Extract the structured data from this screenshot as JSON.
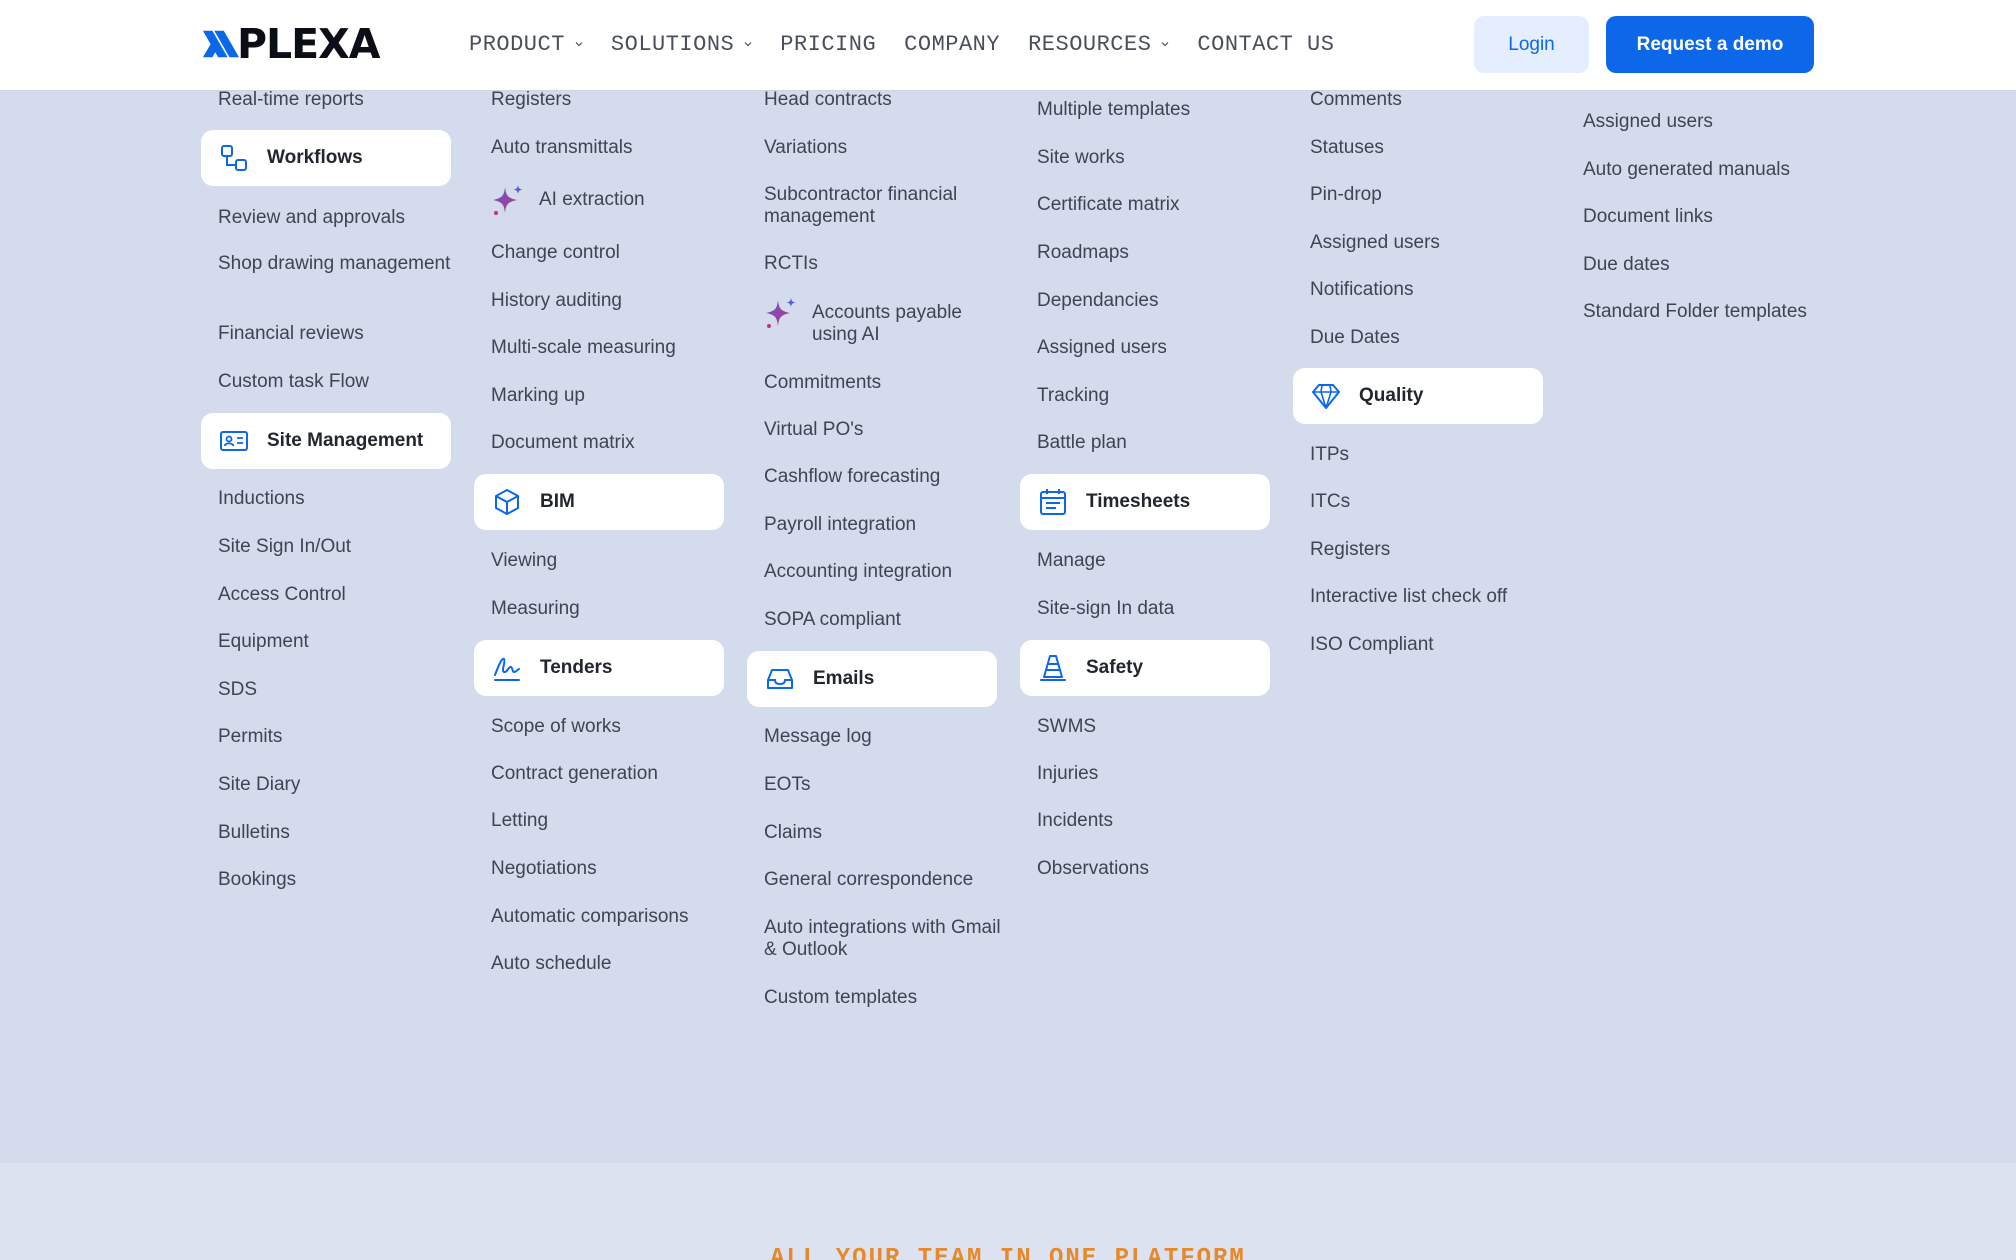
{
  "header": {
    "logo_text": "PLEXA",
    "nav": [
      {
        "label": "PRODUCT",
        "has_dropdown": true
      },
      {
        "label": "SOLUTIONS",
        "has_dropdown": true
      },
      {
        "label": "PRICING",
        "has_dropdown": false
      },
      {
        "label": "COMPANY",
        "has_dropdown": false
      },
      {
        "label": "RESOURCES",
        "has_dropdown": true
      },
      {
        "label": "CONTACT US",
        "has_dropdown": false
      }
    ],
    "login_label": "Login",
    "demo_label": "Request a demo",
    "brand_color": "#0c68e9"
  },
  "menu": {
    "col1": {
      "items": [
        "Real-time reports",
        "Review and approvals",
        "Shop drawing management",
        "Financial reviews",
        "Custom task Flow",
        "Inductions",
        "Site Sign In/Out",
        "Access Control",
        "Equipment",
        "SDS",
        "Permits",
        "Site Diary",
        "Bulletins",
        "Bookings"
      ],
      "cards": [
        {
          "label": "Workflows",
          "icon": "workflow-icon"
        },
        {
          "label": "Site Management",
          "icon": "id-card-icon"
        }
      ]
    },
    "col2": {
      "items": [
        "Registers",
        "Auto transmittals",
        "AI extraction",
        "Change control",
        "History auditing",
        "Multi-scale measuring",
        "Marking up",
        "Document matrix",
        "Viewing",
        "Measuring",
        "Scope of works",
        "Contract generation",
        "Letting",
        "Negotiations",
        "Automatic comparisons",
        "Auto schedule"
      ],
      "cards": [
        {
          "label": "BIM",
          "icon": "cube-icon"
        },
        {
          "label": "Tenders",
          "icon": "signature-icon"
        }
      ]
    },
    "col3": {
      "items": [
        "Head contracts",
        "Variations",
        "Subcontractor financial management",
        "RCTIs",
        "Accounts payable using AI",
        "Commitments",
        "Virtual PO's",
        "Cashflow forecasting",
        "Payroll integration",
        "Accounting integration",
        "SOPA compliant",
        "Message log",
        "EOTs",
        "Claims",
        "General correspondence",
        "Auto integrations with Gmail & Outlook",
        "Custom templates"
      ],
      "cards": [
        {
          "label": "Emails",
          "icon": "inbox-icon"
        }
      ]
    },
    "col4": {
      "items": [
        "Multiple templates",
        "Site works",
        "Certificate matrix",
        "Roadmaps",
        "Dependancies",
        "Assigned users",
        "Tracking",
        "Battle plan",
        "Manage",
        "Site-sign In data",
        "SWMS",
        "Injuries",
        "Incidents",
        "Observations"
      ],
      "cards": [
        {
          "label": "Timesheets",
          "icon": "calendar-icon"
        },
        {
          "label": "Safety",
          "icon": "cone-icon"
        }
      ]
    },
    "col5": {
      "items": [
        "Comments",
        "Statuses",
        "Pin-drop",
        "Assigned users",
        "Notifications",
        "Due Dates",
        "ITPs",
        "ITCs",
        "Registers",
        "Interactive list check off",
        "ISO Compliant"
      ],
      "cards": [
        {
          "label": "Quality",
          "icon": "diamond-icon"
        }
      ]
    },
    "col6": {
      "items": [
        "Assigned users",
        "Auto generated manuals",
        "Document links",
        "Due dates",
        "Standard Folder templates"
      ]
    }
  },
  "lower": {
    "heading": "ALL YOUR TEAM IN ONE PLATFORM",
    "heading_color": "#e6892a"
  }
}
